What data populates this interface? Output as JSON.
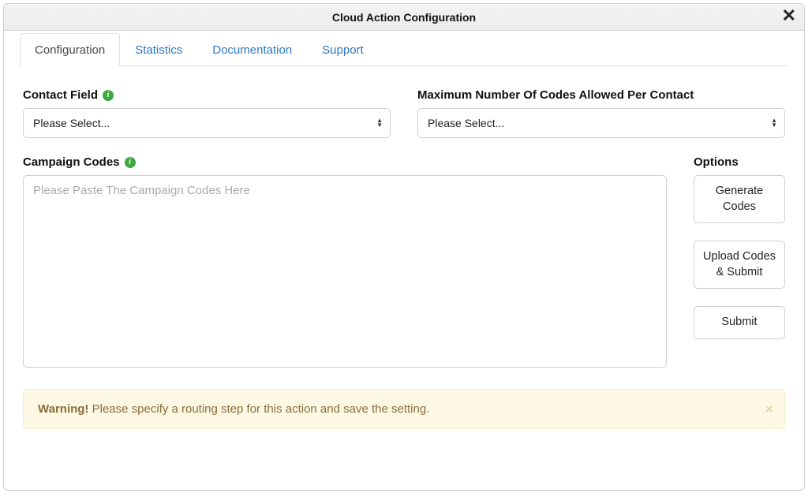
{
  "dialog": {
    "title": "Cloud Action Configuration"
  },
  "tabs": {
    "configuration": "Configuration",
    "statistics": "Statistics",
    "documentation": "Documentation",
    "support": "Support"
  },
  "form": {
    "contact_field": {
      "label": "Contact Field",
      "placeholder": "Please Select..."
    },
    "max_codes": {
      "label": "Maximum Number Of Codes Allowed Per Contact",
      "placeholder": "Please Select..."
    },
    "campaign_codes": {
      "label": "Campaign Codes",
      "placeholder": "Please Paste The Campaign Codes Here"
    }
  },
  "options": {
    "label": "Options",
    "generate": "Generate Codes",
    "upload": "Upload Codes & Submit",
    "submit": "Submit"
  },
  "alert": {
    "strong": "Warning!",
    "text": " Please specify a routing step for this action and save the setting."
  }
}
